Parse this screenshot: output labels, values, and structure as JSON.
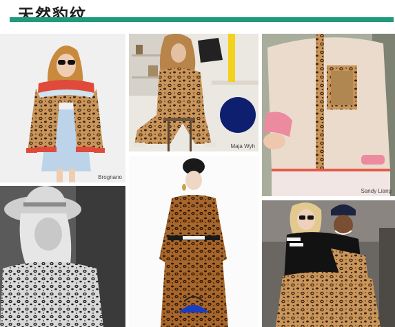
{
  "header": {
    "title": "天然豹纹"
  },
  "colors": {
    "accent": "#1f9a7e"
  },
  "photos": [
    {
      "id": "brognano",
      "caption": "Brognano"
    },
    {
      "id": "maja",
      "caption": "Maja Wyh"
    },
    {
      "id": "sandy",
      "caption": "Sandy Liang"
    },
    {
      "id": "hat",
      "caption": ""
    },
    {
      "id": "dress",
      "caption": ""
    },
    {
      "id": "street",
      "caption": ""
    }
  ]
}
